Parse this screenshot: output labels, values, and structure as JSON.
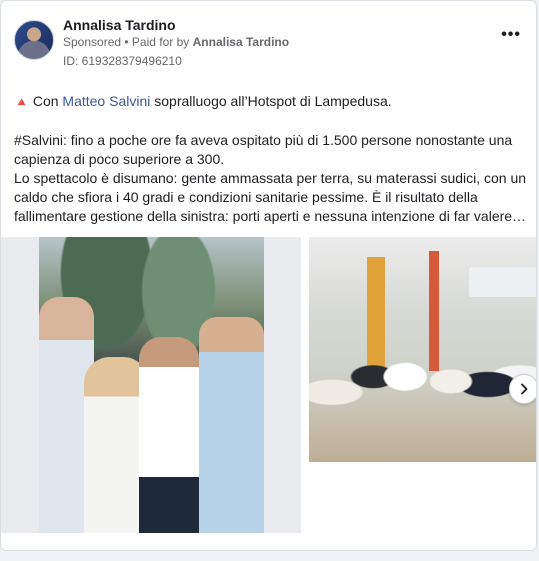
{
  "post": {
    "author": "Annalisa Tardino",
    "sponsored_label": "Sponsored",
    "separator": " • ",
    "paid_prefix": "Paid for by ",
    "paid_by": "Annalisa Tardino",
    "ad_id": "ID: 619328379496210",
    "more_label": "•••"
  },
  "text": {
    "line1_icon": "🔺",
    "line1_prefix": " Con ",
    "mention": "Matteo Salvini",
    "line1_suffix": " sopralluogo all’Hotspot di Lampedusa.",
    "para2": "#Salvini: fino a poche ore fa aveva ospitato più di 1.500 persone nonostante una capienza di poco superiore a 300.",
    "para3": "Lo spettacolo è disumano: gente ammassata per terra, su materassi sudici, con un caldo che sfiora i 40 gradi e condizioni sanitarie pessime. È il risultato della fallimentare gestione della sinistra: porti aperti e nessuna intenzione di far valere…"
  },
  "media": {
    "image1_alt": "photo",
    "image2_alt": "photo",
    "next_icon": "chevron-right-icon"
  },
  "colors": {
    "mention": "#385898",
    "secondary_text": "#65676b",
    "accent_triangle": "#e0392b"
  }
}
